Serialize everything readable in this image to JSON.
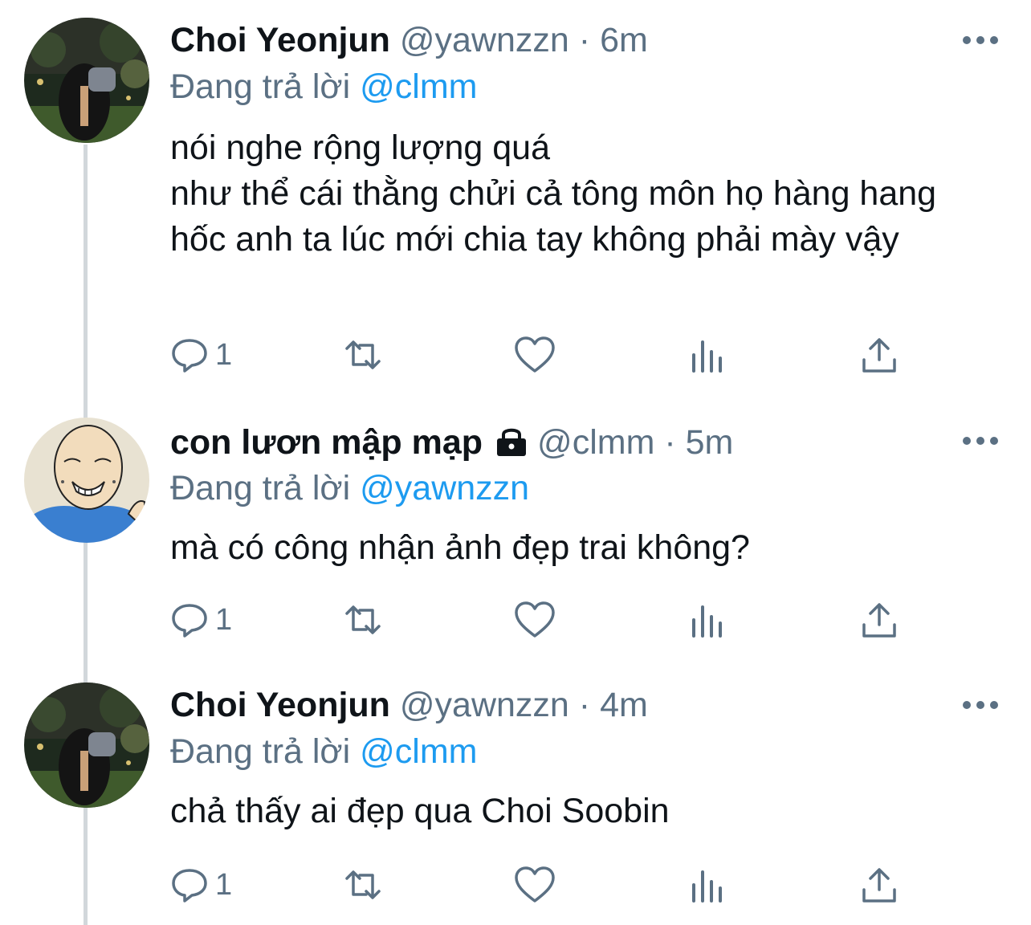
{
  "reply_prefix": "Đang trả lời",
  "tweets": [
    {
      "name": "Choi Yeonjun",
      "handle": "@yawnzzn",
      "separator": "·",
      "time": "6m",
      "replying_to": "@clmm",
      "text": "nói nghe rộng lượng quá\nnhư thể cái thằng chửi cả tông môn họ hàng hang hốc anh ta lúc mới chia tay không phải mày vậy",
      "reply_count": "1",
      "avatar": "night-photo-avatar"
    },
    {
      "name": "con lươn mập mạp",
      "handle": "@clmm",
      "separator": "·",
      "time": "5m",
      "replying_to": "@yawnzzn",
      "text": "mà có công nhận ảnh đẹp trai không?",
      "reply_count": "1",
      "protected": true,
      "avatar": "cartoon-man-avatar"
    },
    {
      "name": "Choi Yeonjun",
      "handle": "@yawnzzn",
      "separator": "·",
      "time": "4m",
      "replying_to": "@clmm",
      "text": "chả thấy ai đẹp qua Choi Soobin",
      "reply_count": "1",
      "avatar": "night-photo-avatar"
    }
  ],
  "icons": [
    "reply-icon",
    "retweet-icon",
    "like-icon",
    "analytics-icon",
    "share-icon",
    "more-icon",
    "lock-icon"
  ],
  "colors": {
    "text": "#0f1419",
    "secondary": "#5b7083",
    "link": "#1d9bf0",
    "thread_line": "#d2d7db"
  }
}
